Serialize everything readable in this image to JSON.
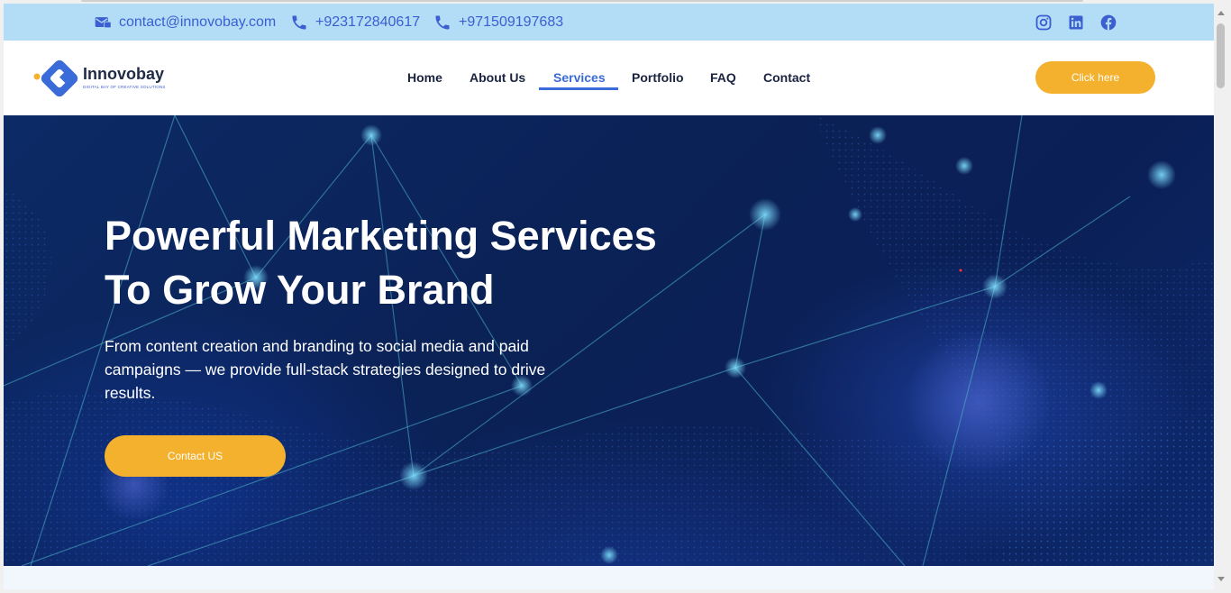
{
  "topbar": {
    "email": "contact@innovobay.com",
    "phone1": "+923172840617",
    "phone2": "+971509197683",
    "social_icons": [
      "instagram-icon",
      "linkedin-icon",
      "facebook-icon"
    ],
    "text_color": "#3b5fd1",
    "bg_color": "#b3dcf6"
  },
  "logo": {
    "name": "Innovobay",
    "tagline": "DIGITAL BAY OF CREATIVE SOLUTIONS"
  },
  "nav": {
    "items": [
      "Home",
      "About Us",
      "Services",
      "Portfolio",
      "FAQ",
      "Contact"
    ],
    "active": "Services",
    "cta_label": "Click here"
  },
  "hero": {
    "title_line1": "Powerful Marketing Services",
    "title_line2": "To Grow Your Brand",
    "description": "From content creation and branding to social media and paid campaigns — we provide full-stack strategies designed to drive results.",
    "cta_label": "Contact US"
  },
  "colors": {
    "accent": "#f3b12d",
    "nav_active": "#3b6bd8",
    "hero_bg": "#0b2257"
  }
}
